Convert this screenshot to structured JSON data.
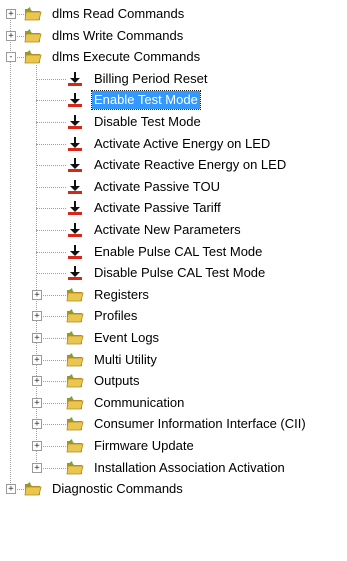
{
  "tree": {
    "nodes": [
      {
        "label": "dlms Read Commands",
        "level": 0,
        "kind": "folder",
        "expander": "+"
      },
      {
        "label": "dlms Write Commands",
        "level": 0,
        "kind": "folder",
        "expander": "+"
      },
      {
        "label": "dlms Execute Commands",
        "level": 0,
        "kind": "folder",
        "expander": "-"
      },
      {
        "label": "Billing Period Reset",
        "level": 1,
        "kind": "command"
      },
      {
        "label": "Enable Test Mode",
        "level": 1,
        "kind": "command",
        "selected": true
      },
      {
        "label": "Disable Test Mode",
        "level": 1,
        "kind": "command"
      },
      {
        "label": "Activate Active Energy on LED",
        "level": 1,
        "kind": "command"
      },
      {
        "label": "Activate Reactive Energy on LED",
        "level": 1,
        "kind": "command"
      },
      {
        "label": "Activate Passive TOU",
        "level": 1,
        "kind": "command"
      },
      {
        "label": "Activate Passive Tariff",
        "level": 1,
        "kind": "command"
      },
      {
        "label": "Activate New Parameters",
        "level": 1,
        "kind": "command"
      },
      {
        "label": "Enable Pulse CAL Test Mode",
        "level": 1,
        "kind": "command"
      },
      {
        "label": "Disable Pulse CAL Test Mode",
        "level": 1,
        "kind": "command"
      },
      {
        "label": "Registers",
        "level": 1,
        "kind": "folder",
        "expander": "+"
      },
      {
        "label": "Profiles",
        "level": 1,
        "kind": "folder",
        "expander": "+"
      },
      {
        "label": "Event Logs",
        "level": 1,
        "kind": "folder",
        "expander": "+"
      },
      {
        "label": "Multi Utility",
        "level": 1,
        "kind": "folder",
        "expander": "+"
      },
      {
        "label": "Outputs",
        "level": 1,
        "kind": "folder",
        "expander": "+"
      },
      {
        "label": "Communication",
        "level": 1,
        "kind": "folder",
        "expander": "+"
      },
      {
        "label": "Consumer Information Interface (CII)",
        "level": 1,
        "kind": "folder",
        "expander": "+"
      },
      {
        "label": "Firmware Update",
        "level": 1,
        "kind": "folder",
        "expander": "+"
      },
      {
        "label": "Installation Association Activation",
        "level": 1,
        "kind": "folder",
        "expander": "+"
      },
      {
        "label": "Diagnostic Commands",
        "level": 0,
        "kind": "folder",
        "expander": "+"
      }
    ]
  },
  "colors": {
    "selection": "#3399ff",
    "folder": "#e8c650",
    "folder_dark": "#b98a1c",
    "folder_green": "#6fa832",
    "command_arrow": "#111111",
    "command_base": "#d8261a"
  },
  "icons": {
    "folder": "folder-icon",
    "command": "execute-command-icon",
    "expand": "plus-expander-icon",
    "collapse": "minus-expander-icon"
  }
}
